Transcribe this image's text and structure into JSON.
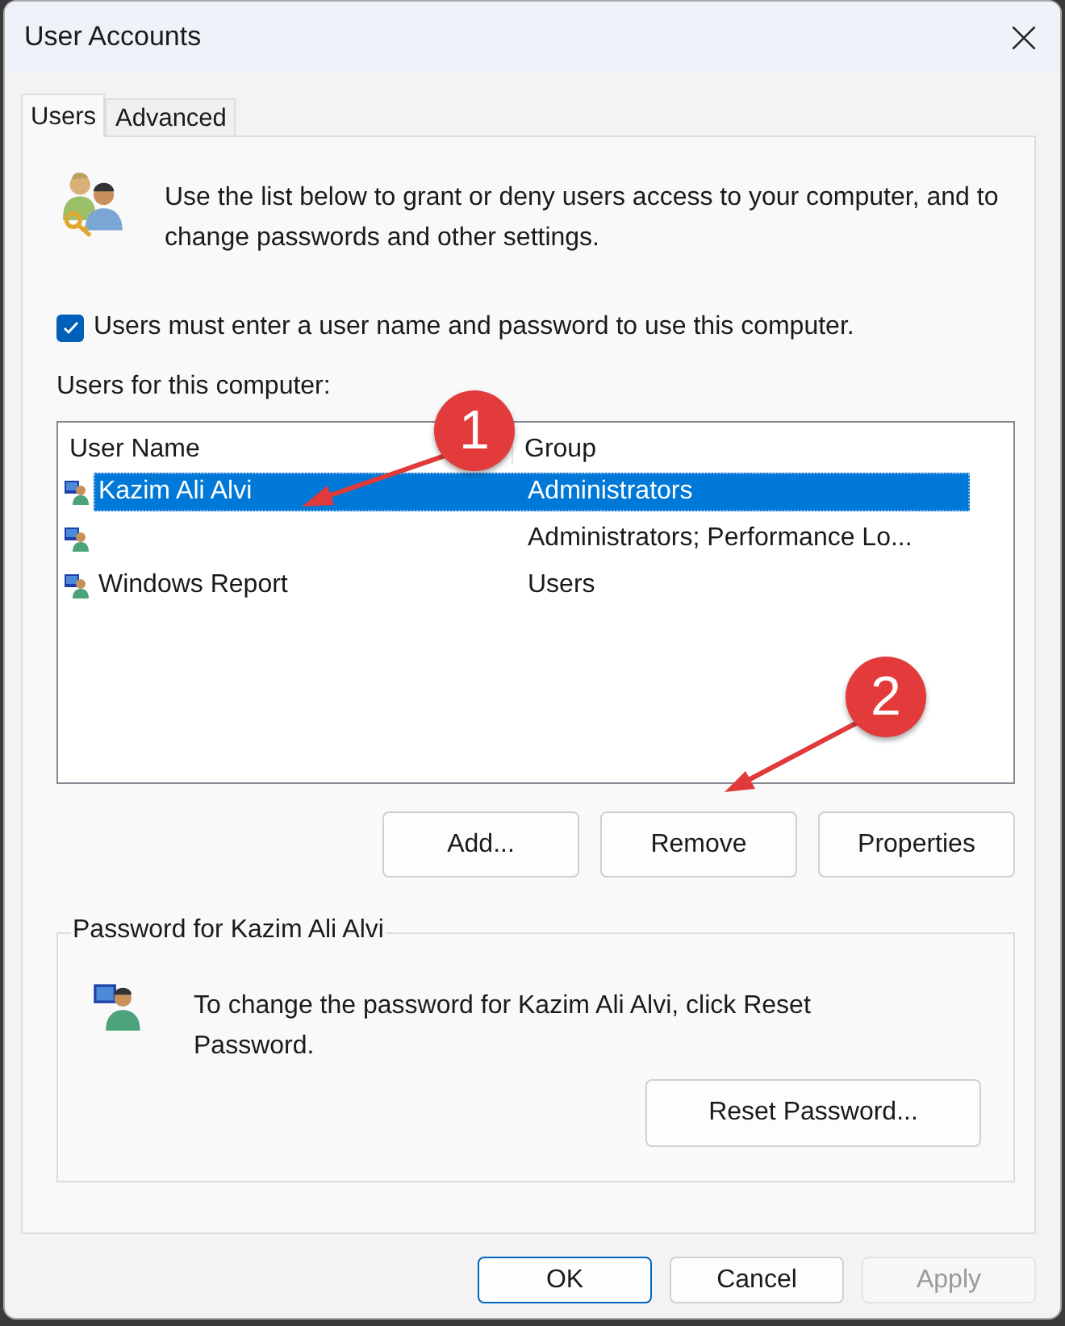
{
  "window": {
    "title": "User Accounts"
  },
  "tabs": [
    {
      "label": "Users",
      "selected": true
    },
    {
      "label": "Advanced",
      "selected": false
    }
  ],
  "intro": "Use the list below to grant or deny users access to your computer, and to change passwords and other settings.",
  "require_login": {
    "label": "Users must enter a user name and password to use this computer.",
    "checked": true
  },
  "users_label": "Users for this computer:",
  "table": {
    "columns": [
      "User Name",
      "Group"
    ],
    "rows": [
      {
        "name": "Kazim Ali Alvi",
        "group": "Administrators",
        "selected": true
      },
      {
        "group": "Administrators; Performance Lo...",
        "selected": false
      },
      {
        "name": "Windows Report",
        "group": "Users",
        "selected": false
      }
    ]
  },
  "list_buttons": [
    "Add...",
    "Remove",
    "Properties"
  ],
  "password_group": {
    "legend": "Password for Kazim Ali Alvi",
    "text": "To change the password for Kazim Ali Alvi, click Reset Password.",
    "button": "Reset Password..."
  },
  "dialog_buttons": [
    {
      "label": "OK",
      "kind": "default",
      "disabled": false
    },
    {
      "label": "Cancel",
      "kind": "normal",
      "disabled": false
    },
    {
      "label": "Apply",
      "kind": "normal",
      "disabled": true
    }
  ],
  "annotations": [
    {
      "label": "1"
    },
    {
      "label": "2"
    }
  ]
}
